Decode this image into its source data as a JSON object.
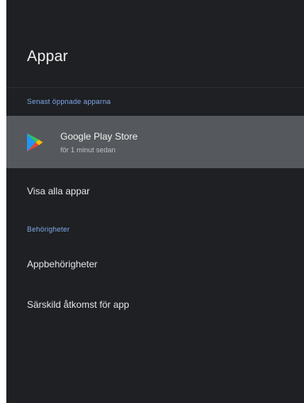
{
  "page": {
    "title": "Appar"
  },
  "sections": {
    "recent": {
      "header": "Senast öppnade apparna"
    },
    "permissions": {
      "header": "Behörigheter"
    }
  },
  "recent_apps": [
    {
      "name": "Google Play Store",
      "subtitle": "för 1 minut sedan",
      "icon": "google-play-icon"
    }
  ],
  "menu": {
    "see_all": "Visa alla appar",
    "app_permissions": "Appbehörigheter",
    "special_access": "Särskild åtkomst för app"
  },
  "colors": {
    "background": "#1e2023",
    "selected_row": "#55585c",
    "section_header": "#7ea7e8",
    "text_primary": "#f1f1f1",
    "text_secondary": "#bfc1c4"
  }
}
